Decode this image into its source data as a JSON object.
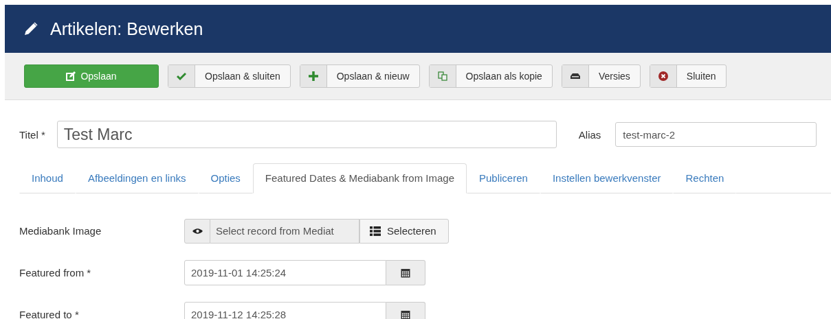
{
  "header": {
    "title": "Artikelen: Bewerken"
  },
  "toolbar": [
    {
      "label": "Opslaan",
      "kind": "primary"
    },
    {
      "label": "Opslaan & sluiten",
      "kind": "default"
    },
    {
      "label": "Opslaan & nieuw",
      "kind": "default"
    },
    {
      "label": "Opslaan als kopie",
      "kind": "default"
    },
    {
      "label": "Versies",
      "kind": "default"
    },
    {
      "label": "Sluiten",
      "kind": "default"
    }
  ],
  "title_field": {
    "label": "Titel *",
    "value": "Test Marc"
  },
  "alias_field": {
    "label": "Alias",
    "value": "test-marc-2"
  },
  "tabs": [
    {
      "label": "Inhoud",
      "selected": false
    },
    {
      "label": "Afbeeldingen en links",
      "selected": false
    },
    {
      "label": "Opties",
      "selected": false
    },
    {
      "label": "Featured Dates & Mediabank from Image",
      "selected": true
    },
    {
      "label": "Publiceren",
      "selected": false
    },
    {
      "label": "Instellen bewerkvenster",
      "selected": false
    },
    {
      "label": "Rechten",
      "selected": false
    }
  ],
  "fields": [
    {
      "kind": "media",
      "label": "Mediabank Image",
      "value": "Select record from Mediat",
      "button": "Selecteren"
    },
    {
      "kind": "date",
      "label": "Featured from *",
      "value": "2019-11-01 14:25:24"
    },
    {
      "kind": "date",
      "label": "Featured to *",
      "value": "2019-11-12 14:25:28"
    }
  ]
}
